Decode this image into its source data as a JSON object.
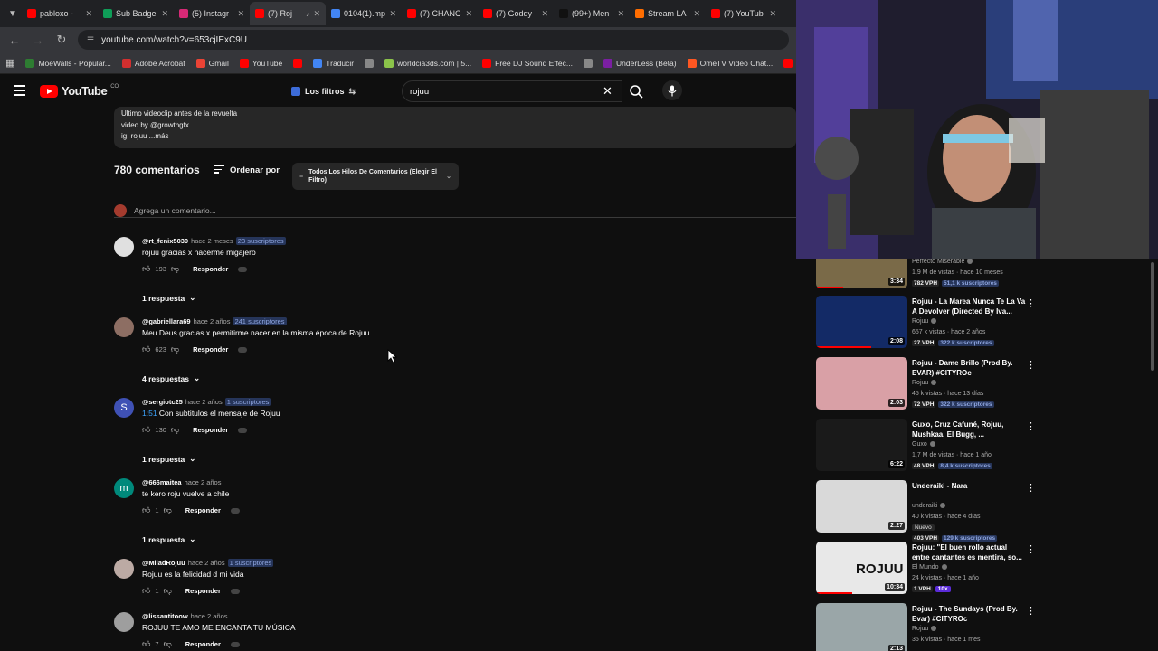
{
  "tabs": [
    {
      "title": "pabloxo -",
      "color": "#ff0000",
      "active": false
    },
    {
      "title": "Sub Badge",
      "color": "#0f9d58",
      "active": false
    },
    {
      "title": "(5) Instagr",
      "color": "#d62976",
      "active": false
    },
    {
      "title": "(7) Roj",
      "color": "#ff0000",
      "active": true
    },
    {
      "title": "0104(1).mp",
      "color": "#4285f4",
      "active": false
    },
    {
      "title": "(7) CHANC",
      "color": "#ff0000",
      "active": false
    },
    {
      "title": "(7) Goddy",
      "color": "#ff0000",
      "active": false
    },
    {
      "title": "(99+) Men",
      "color": "#111111",
      "active": false
    },
    {
      "title": "Stream LA",
      "color": "#ff6d00",
      "active": false
    },
    {
      "title": "(7) YouTub",
      "color": "#ff0000",
      "active": false
    }
  ],
  "address": {
    "url": "youtube.com/watch?v=653cjIExC9U"
  },
  "bookmarks": [
    {
      "label": "MoeWalls - Popular...",
      "color": "#2e7d32"
    },
    {
      "label": "Adobe Acrobat",
      "color": "#d32f2f"
    },
    {
      "label": "Gmail",
      "color": "#ea4335"
    },
    {
      "label": "YouTube",
      "color": "#ff0000"
    },
    {
      "label": "",
      "color": "#ff0000"
    },
    {
      "label": "Traducir",
      "color": "#4285f4"
    },
    {
      "label": "",
      "color": "#888888"
    },
    {
      "label": "worldcia3ds.com | 5...",
      "color": "#8bc34a"
    },
    {
      "label": "Free DJ Sound Effec...",
      "color": "#ff0000"
    },
    {
      "label": "",
      "color": "#888888"
    },
    {
      "label": "UnderLess (Beta)",
      "color": "#7b1fa2"
    },
    {
      "label": "OmeTV Video Chat...",
      "color": "#ff5722"
    },
    {
      "label": "Ch",
      "color": "#ff0000"
    }
  ],
  "header": {
    "logo_text": "YouTube",
    "country": "CO",
    "filters_label": "Los filtros",
    "search_value": "rojuu"
  },
  "description": {
    "line1": "Ultimo videoclip antes de la revuelta",
    "line2": "video by @growthgfx",
    "line3": "ig: rojuu ...más"
  },
  "comments_header": {
    "count_label": "780 comentarios",
    "sort_label": "Ordenar por",
    "thread_filter": "Todos Los Hilos De Comentarios (Elegir El Filtro)",
    "add_placeholder": "Agrega un comentario..."
  },
  "comments": [
    {
      "author": "@rt_fenix5030",
      "when": "hace 2 meses",
      "subs": "23 suscriptores",
      "timestamp": "",
      "text": "rojuu gracias x hacerme migajero",
      "likes": "193",
      "reply_label": "Responder",
      "replies": "1 respuesta",
      "avatar_letter": "",
      "avatar_color": "#e0e0e0"
    },
    {
      "author": "@gabriellara69",
      "when": "hace 2 años",
      "subs": "241 suscriptores",
      "timestamp": "",
      "text": "Meu Deus gracias x permitirme nacer en la misma época de Rojuu",
      "likes": "623",
      "reply_label": "Responder",
      "replies": "4 respuestas",
      "avatar_letter": "",
      "avatar_color": "#8d6e63"
    },
    {
      "author": "@sergiotc25",
      "when": "hace 2 años",
      "subs": "1 suscriptores",
      "timestamp": "1:51",
      "text": " Con subtitulos el mensaje de Rojuu",
      "likes": "130",
      "reply_label": "Responder",
      "replies": "1 respuesta",
      "avatar_letter": "S",
      "avatar_color": "#3f51b5"
    },
    {
      "author": "@666maitea",
      "when": "hace 2 años",
      "subs": "",
      "timestamp": "",
      "text": "te kero roju vuelve a chile",
      "likes": "1",
      "reply_label": "Responder",
      "replies": "1 respuesta",
      "avatar_letter": "m",
      "avatar_color": "#00897b"
    },
    {
      "author": "@MiladRojuu",
      "when": "hace 2 años",
      "subs": "1 suscriptores",
      "timestamp": "",
      "text": "Rojuu es la felicidad d mi vida",
      "likes": "1",
      "reply_label": "Responder",
      "replies": "",
      "avatar_letter": "",
      "avatar_color": "#bcaaa4"
    },
    {
      "author": "@lissantitoow",
      "when": "hace 2 años",
      "subs": "",
      "timestamp": "",
      "text": "ROJUU TE AMO ME ENCANTA TU MÚSICA",
      "likes": "7",
      "reply_label": "Responder",
      "replies": "",
      "avatar_letter": "",
      "avatar_color": "#9e9e9e"
    }
  ],
  "recommendations": [
    {
      "title": "",
      "channel": "Perfecto Miserable",
      "meta": "1,9 M de vistas · hace 10 meses",
      "vph": "782 VPH",
      "subs": "51,1 k suscriptores",
      "outlier": "",
      "is_new": "",
      "duration": "3:34",
      "thumb_color": "#7a6a48",
      "progress": 0.3
    },
    {
      "title": "Rojuu - La Marea Nunca Te La Va A Devolver (Directed By Iva...",
      "channel": "Rojuu",
      "meta": "657 k vistas · hace 2 años",
      "vph": "27 VPH",
      "subs": "322 k suscriptores",
      "outlier": "",
      "is_new": "",
      "duration": "2:08",
      "thumb_color": "#132a66",
      "progress": 0.6
    },
    {
      "title": "Rojuu - Dame Brillo (Prod By. EVAR) #CITYROc",
      "channel": "Rojuu",
      "meta": "45 k vistas · hace 13 días",
      "vph": "72 VPH",
      "subs": "322 k suscriptores",
      "outlier": "",
      "is_new": "",
      "duration": "2:03",
      "thumb_color": "#d9a0a6",
      "progress": 0.0
    },
    {
      "title": "Guxo, Cruz Cafuné, Rojuu, Mushkaa, El Bugg, ...",
      "channel": "Guxo",
      "meta": "1,7 M de vistas · hace 1 año",
      "vph": "48 VPH",
      "subs": "8,4 k suscriptores",
      "outlier": "",
      "is_new": "",
      "duration": "6:22",
      "thumb_color": "#1a1a1a",
      "progress": 0.0
    },
    {
      "title": "Underaiki - Nara",
      "channel": "underaiki",
      "meta": "40 k vistas · hace 4 días",
      "vph": "403 VPH",
      "subs": "129 k suscriptores",
      "outlier": "",
      "is_new": "Nuevo",
      "duration": "2:27",
      "thumb_color": "#d9d9d9",
      "progress": 0.0
    },
    {
      "title": "Rojuu: \"El buen rollo actual entre cantantes es mentira, so...",
      "channel": "El Mundo",
      "meta": "24 k vistas · hace 1 año",
      "vph": "1 VPH",
      "subs": "",
      "outlier": "10x",
      "is_new": "",
      "duration": "10:34",
      "thumb_color": "#e8e8e8",
      "progress": 0.4
    },
    {
      "title": "Rojuu - The Sundays (Prod By. Evar) #CITYROc",
      "channel": "Rojuu",
      "meta": "35 k vistas · hace 1 mes",
      "vph": "",
      "subs": "",
      "outlier": "",
      "is_new": "",
      "duration": "2:13",
      "thumb_color": "#9aa6a8",
      "progress": 0.0
    }
  ],
  "thumb_overlay_text": "ROJUU",
  "colors": {
    "brand": "#ff0000",
    "link": "#3ea6ff",
    "background": "#0f0f0f"
  }
}
